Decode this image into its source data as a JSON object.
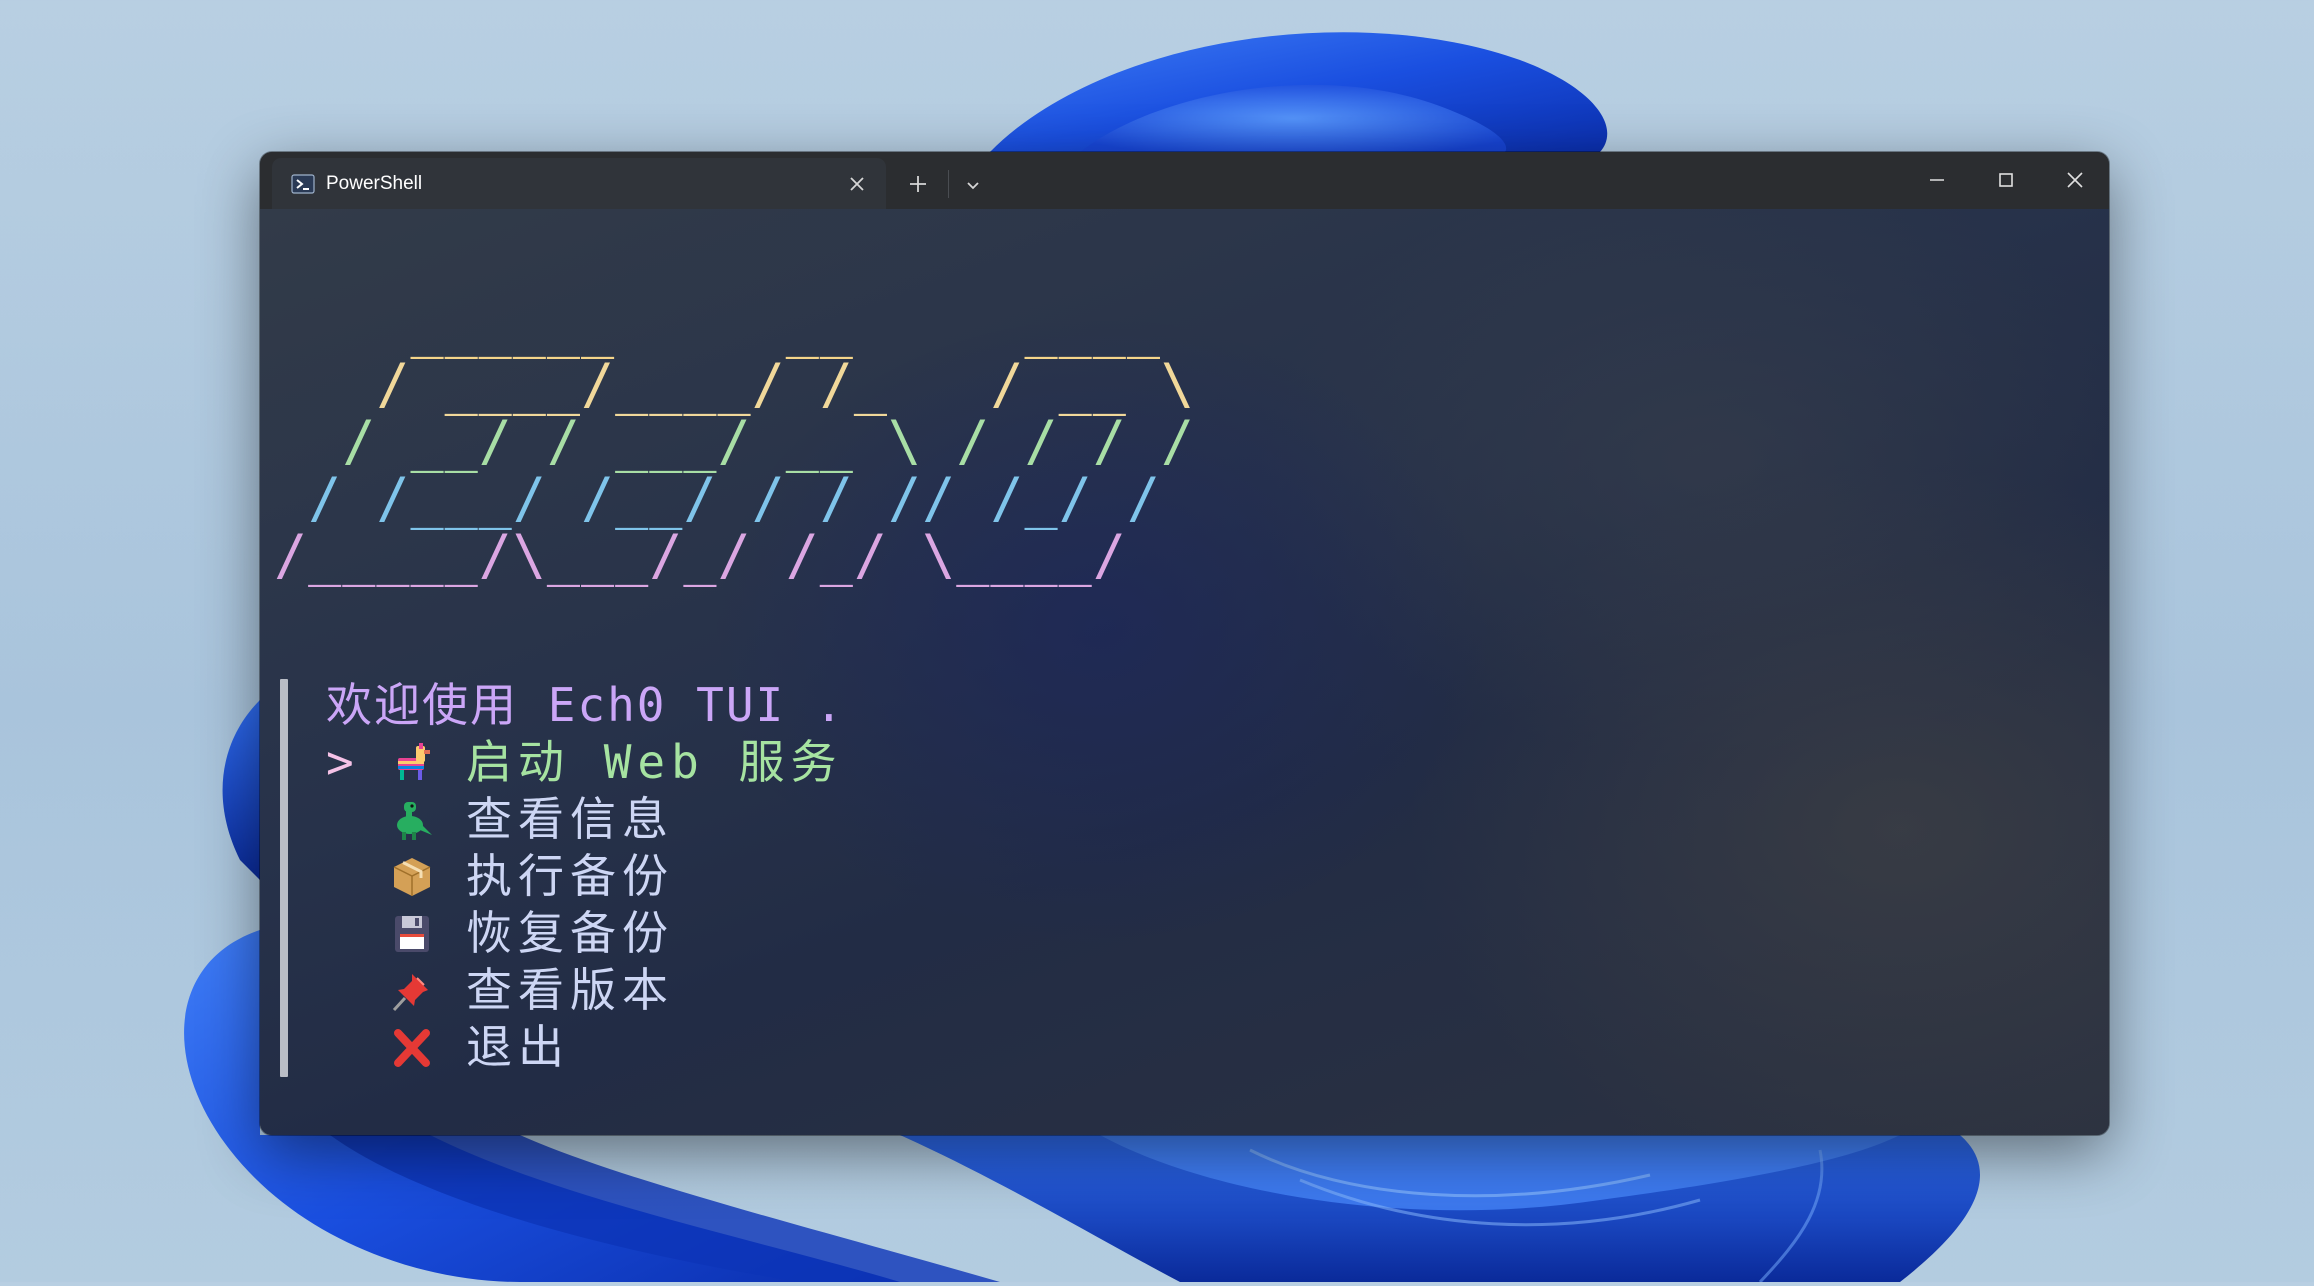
{
  "window": {
    "tab_title": "PowerShell",
    "tab_icon": "powershell-icon"
  },
  "banner": {
    "lines": [
      "    ______     __     ____ ",
      "   / ____/____/ /_   / __ \\",
      "  / __/ / ___/ __ \\ / / / /",
      " / /___/ /__/ / / // /_/ / ",
      "/_____/\\___/_/ /_/ \\____/  "
    ],
    "colors": [
      "#f5d58a",
      "#f1d89a",
      "#a8dea5",
      "#7fc4ea",
      "#dba6e2"
    ]
  },
  "menu": {
    "title": "欢迎使用 Ech0 TUI .",
    "cursor": ">",
    "items": [
      {
        "icon": "pinata-icon",
        "label": "启动 Web 服务",
        "selected": true
      },
      {
        "icon": "dinosaur-icon",
        "label": "查看信息",
        "selected": false
      },
      {
        "icon": "package-icon",
        "label": "执行备份",
        "selected": false
      },
      {
        "icon": "floppy-disk-icon",
        "label": "恢复备份",
        "selected": false
      },
      {
        "icon": "pushpin-icon",
        "label": "查看版本",
        "selected": false
      },
      {
        "icon": "cross-mark-icon",
        "label": "退出",
        "selected": false
      }
    ],
    "colors": {
      "title": "#cba6f7",
      "selected": "#a6e3a1",
      "normal": "#cdd6f4",
      "cursor": "#f5c2e7"
    }
  }
}
